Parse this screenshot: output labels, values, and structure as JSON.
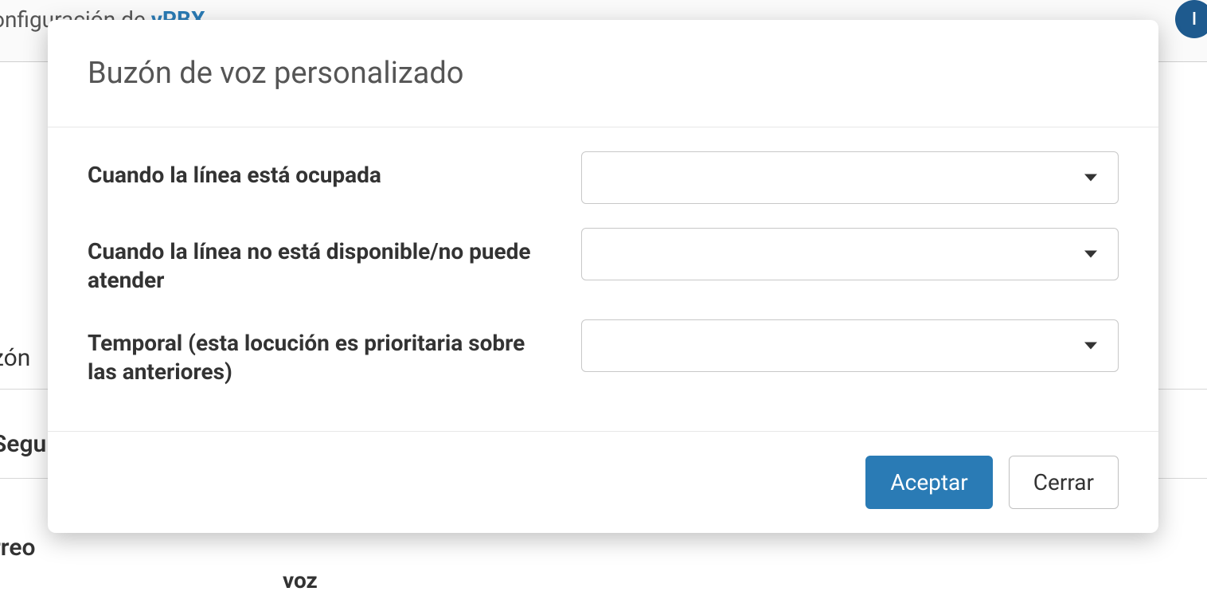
{
  "background": {
    "header_text": "onfiguración de ",
    "brand": "vPBX",
    "avatar_initial": "I",
    "sidebar_text1": "zón",
    "sidebar_text2": "Segu",
    "sidebar_text3": "rreo",
    "voz": "voz"
  },
  "modal": {
    "title": "Buzón de voz personalizado",
    "fields": {
      "busy": {
        "label": "Cuando la línea está ocupada",
        "value": ""
      },
      "unavailable": {
        "label": "Cuando la línea no está disponible/no puede atender",
        "value": ""
      },
      "temporal": {
        "label": "Temporal (esta locución es prioritaria sobre las anteriores)",
        "value": ""
      }
    },
    "buttons": {
      "accept": "Aceptar",
      "close": "Cerrar"
    }
  }
}
